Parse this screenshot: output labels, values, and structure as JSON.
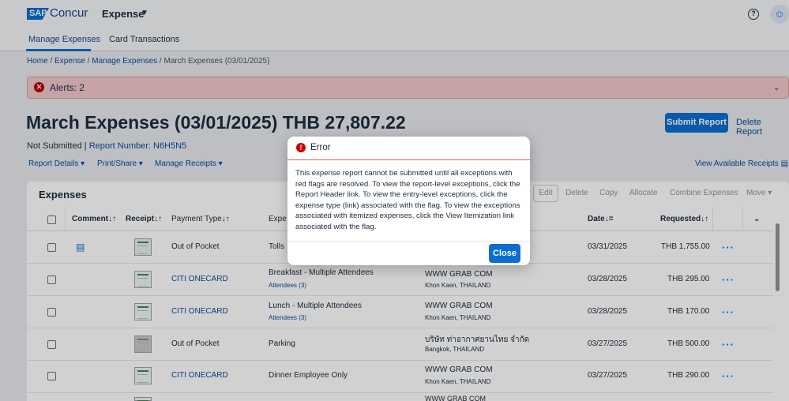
{
  "shell": {
    "logo_sap": "SAP",
    "logo_concur": "Concur",
    "app_title": "Expense",
    "help_icon": "question-circle-icon",
    "user_icon": "person-icon"
  },
  "tabs": [
    "Manage Expenses",
    "Card Transactions"
  ],
  "breadcrumb": {
    "home": "Home",
    "expense": "Expense",
    "manage": "Manage Expenses",
    "current": "March Expenses (03/01/2025)",
    "separator": "/"
  },
  "alert": {
    "text": "Alerts: 2",
    "icon": "error-circle-icon"
  },
  "report": {
    "title": "March Expenses (03/01/2025) THB 27,807.22",
    "status": "Not Submitted",
    "status_sep": "|",
    "report_number": "Report Number: N6H5N5",
    "submit": "Submit Report",
    "delete": "Delete Report"
  },
  "menus": {
    "report_details": "Report Details",
    "print_share": "Print/Share",
    "manage_receipts": "Manage Receipts",
    "view_receipts": "View Available Receipts"
  },
  "expenses": {
    "title": "Expenses",
    "toolbar": {
      "edit": "Edit",
      "delete": "Delete",
      "copy": "Copy",
      "allocate": "Allocate",
      "combine": "Combine Expenses",
      "move": "Move"
    },
    "columns": {
      "comment": "Comment",
      "receipt": "Receipt",
      "payment_type": "Payment Type",
      "expense_type": "Expe",
      "date": "Date",
      "requested": "Requested",
      "sort_icon": "↓↑",
      "date_sort_icon": "↓="
    },
    "rows": [
      {
        "has_comment": true,
        "payment": "Out of Pocket",
        "payment_link": false,
        "type": "Tolls",
        "attendees": "",
        "vendor": "",
        "location": "",
        "date": "03/31/2025",
        "amount": "THB 1,755.00",
        "receipt": "doc"
      },
      {
        "has_comment": false,
        "payment": "CITI ONECARD",
        "payment_link": true,
        "type": "Breakfast - Multiple Attendees",
        "attendees": "Attendees (3)",
        "vendor": "WWW GRAB COM",
        "location": "Khon Kaen, THAILAND",
        "date": "03/28/2025",
        "amount": "THB 295.00",
        "receipt": "green"
      },
      {
        "has_comment": false,
        "payment": "CITI ONECARD",
        "payment_link": true,
        "type": "Lunch - Multiple Attendees",
        "attendees": "Attendees (3)",
        "vendor": "WWW GRAB COM",
        "location": "Khon Kaen, THAILAND",
        "date": "03/28/2025",
        "amount": "THB 170.00",
        "receipt": "green"
      },
      {
        "has_comment": false,
        "payment": "Out of Pocket",
        "payment_link": false,
        "type": "Parking",
        "attendees": "",
        "vendor": "บริษัท ท่าอากาศยานไทย จำกัด",
        "location": "Bangkok, THAILAND",
        "date": "03/27/2025",
        "amount": "THB 500.00",
        "receipt": "grey"
      },
      {
        "has_comment": false,
        "payment": "CITI ONECARD",
        "payment_link": true,
        "type": "Dinner Employee Only",
        "attendees": "",
        "vendor": "WWW GRAB COM",
        "location": "Khon Kaen, THAILAND",
        "date": "03/27/2025",
        "amount": "THB 290.00",
        "receipt": "green"
      },
      {
        "has_comment": false,
        "payment": "",
        "payment_link": false,
        "type": "",
        "attendees": "",
        "vendor": "WWW GRAB COM",
        "location": "",
        "date": "",
        "amount": "",
        "receipt": "green"
      }
    ]
  },
  "dialog": {
    "title": "Error",
    "body": "This expense report cannot be submitted until all exceptions with red flags are resolved. To view the report-level exceptions, click the Report Header link. To view the entry-level exceptions, click the expense type (link) associated with the flag. To view the exceptions associated with itemized expenses, click the View Itemization link associated with the flag.",
    "close": "Close"
  },
  "colors": {
    "accent": "#0a6ed1",
    "link": "#0a4b9a",
    "alert_bg": "#f1c7cc",
    "error": "#cc0000"
  }
}
